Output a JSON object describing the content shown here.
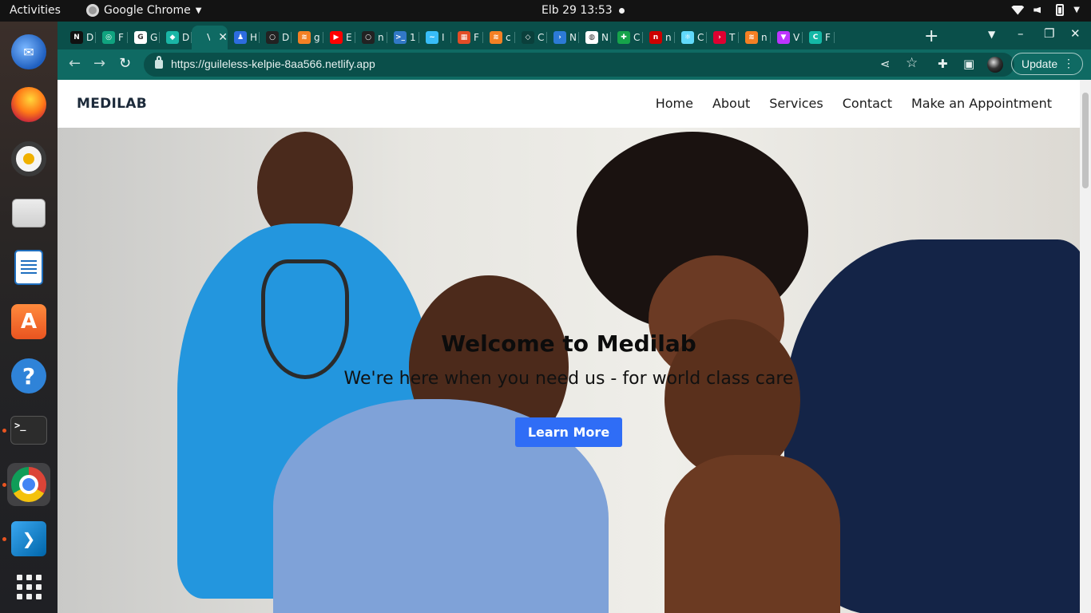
{
  "topbar": {
    "activities": "Activities",
    "app_name": "Google Chrome",
    "clock": "Elb 29  13:53"
  },
  "dock": {
    "apps": [
      "Thunderbird Mail",
      "Firefox Web Browser",
      "Rhythmbox",
      "Files",
      "LibreOffice Writer",
      "Ubuntu Software",
      "Help",
      "Terminal",
      "Google Chrome",
      "Visual Studio Code",
      "Show Applications"
    ],
    "active_app": "Google Chrome"
  },
  "browser": {
    "tabs": [
      {
        "fav": "N",
        "label": "D",
        "color": "#111111"
      },
      {
        "fav": "◎",
        "label": "F",
        "color": "#10a37f"
      },
      {
        "fav": "G",
        "label": "G",
        "color": "#ffffff"
      },
      {
        "fav": "◆",
        "label": "D",
        "color": "#1ab6a6"
      },
      {
        "fav": "",
        "label": "V",
        "color": "#0f6a63",
        "active": true
      },
      {
        "fav": "♟",
        "label": "H",
        "color": "#2d6cdf"
      },
      {
        "fav": "○",
        "label": "D",
        "color": "#222222"
      },
      {
        "fav": "≋",
        "label": "g",
        "color": "#f48024"
      },
      {
        "fav": "▶",
        "label": "E",
        "color": "#ff0000"
      },
      {
        "fav": "○",
        "label": "n",
        "color": "#222222"
      },
      {
        "fav": ">_",
        "label": "1",
        "color": "#3178c6"
      },
      {
        "fav": "~",
        "label": "I",
        "color": "#38bdf8"
      },
      {
        "fav": "▦",
        "label": "F",
        "color": "#e34c26"
      },
      {
        "fav": "≋",
        "label": "c",
        "color": "#f48024"
      },
      {
        "fav": "◇",
        "label": "C",
        "color": "#0a3f3b"
      },
      {
        "fav": "›",
        "label": "N",
        "color": "#2c7ad6"
      },
      {
        "fav": "◍",
        "label": "N",
        "color": "#ffffff"
      },
      {
        "fav": "✚",
        "label": "C",
        "color": "#16a34a"
      },
      {
        "fav": "n",
        "label": "n",
        "color": "#cc0000"
      },
      {
        "fav": "⚛",
        "label": "C",
        "color": "#61dafb"
      },
      {
        "fav": "›",
        "label": "T",
        "color": "#dd0031"
      },
      {
        "fav": "≋",
        "label": "n",
        "color": "#f48024"
      },
      {
        "fav": "▼",
        "label": "V",
        "color": "#bd34fe"
      },
      {
        "fav": "C",
        "label": "F",
        "color": "#14b8a6"
      }
    ],
    "url": "https://guileless-kelpie-8aa566.netlify.app",
    "update_label": "Update"
  },
  "site": {
    "logo": "MEDILAB",
    "nav": [
      "Home",
      "About",
      "Services",
      "Contact",
      "Make an Appointment"
    ],
    "hero": {
      "title": "Welcome to Medilab",
      "subtitle": "We're here when you need us - for world class care",
      "button": "Learn More"
    }
  },
  "colors": {
    "chrome_frame": "#0a4f4a",
    "chrome_toolbar": "#0f6a63",
    "primary_button": "#2f6df6"
  }
}
